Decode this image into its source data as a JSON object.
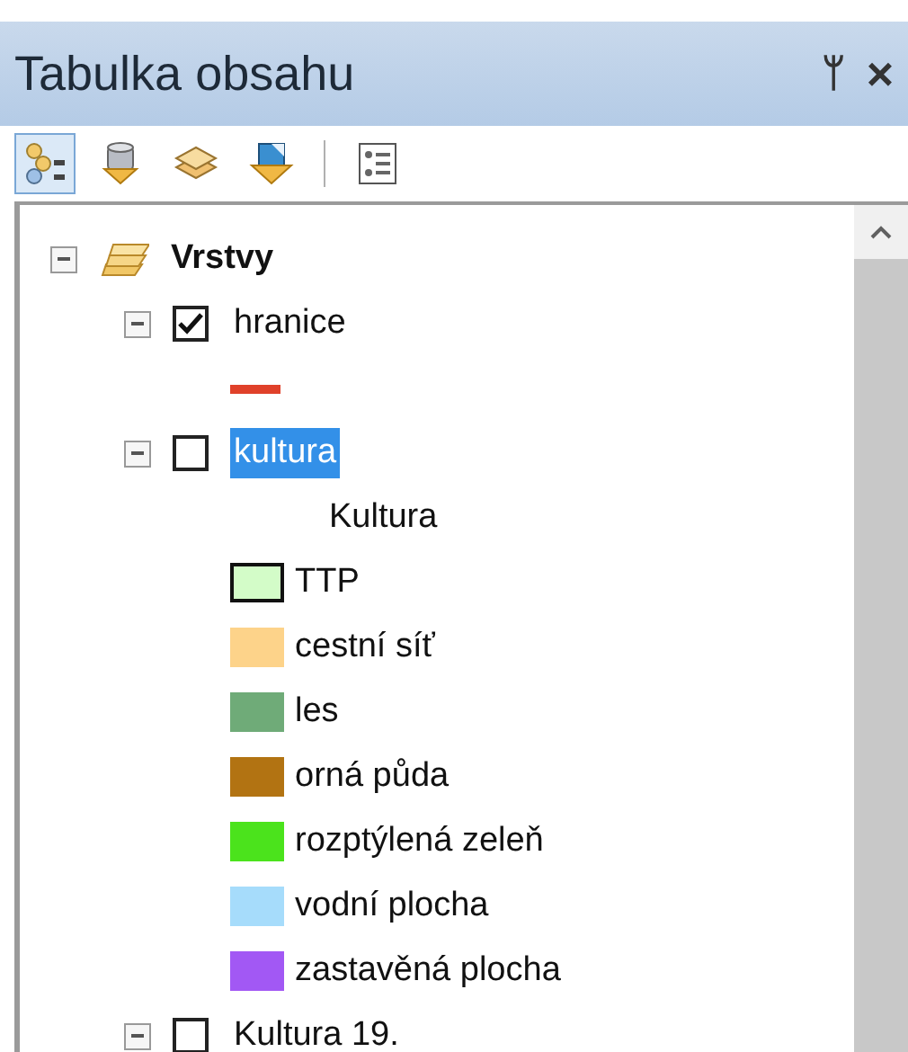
{
  "window": {
    "title": "Tabulka obsahu",
    "pin": "ᛘ",
    "close": "×"
  },
  "toolbar": [
    {
      "kind": "drawing-order",
      "selected": true
    },
    {
      "kind": "source",
      "selected": false
    },
    {
      "kind": "visibility",
      "selected": false
    },
    {
      "kind": "selection",
      "selected": false
    },
    {
      "kind": "options",
      "selected": false
    }
  ],
  "tree": {
    "label": "Vrstvy",
    "expanded": true,
    "children": [
      {
        "label": "hranice",
        "checked": true,
        "expanded": true,
        "selected": false,
        "legend": [
          {
            "kind": "line",
            "color": "#e0412a"
          }
        ]
      },
      {
        "label": "kultura",
        "checked": false,
        "expanded": true,
        "selected": true,
        "heading": "Kultura",
        "legend": [
          {
            "kind": "fill",
            "label": "TTP",
            "color": "#d3fcc8",
            "outline": true
          },
          {
            "kind": "fill",
            "label": "cestní síť",
            "color": "#fdd38a",
            "outline": false
          },
          {
            "kind": "fill",
            "label": "les",
            "color": "#6fab78",
            "outline": false
          },
          {
            "kind": "fill",
            "label": "orná půda",
            "color": "#b27312",
            "outline": false
          },
          {
            "kind": "fill",
            "label": "rozptýlená zeleň",
            "color": "#4be31c",
            "outline": false
          },
          {
            "kind": "fill",
            "label": "vodní plocha",
            "color": "#a6dcfb",
            "outline": false
          },
          {
            "kind": "fill",
            "label": "zastavěná plocha",
            "color": "#a258f4",
            "outline": false
          }
        ]
      },
      {
        "label": "Kultura 19.",
        "checked": false,
        "expanded": true,
        "selected": false
      }
    ]
  }
}
